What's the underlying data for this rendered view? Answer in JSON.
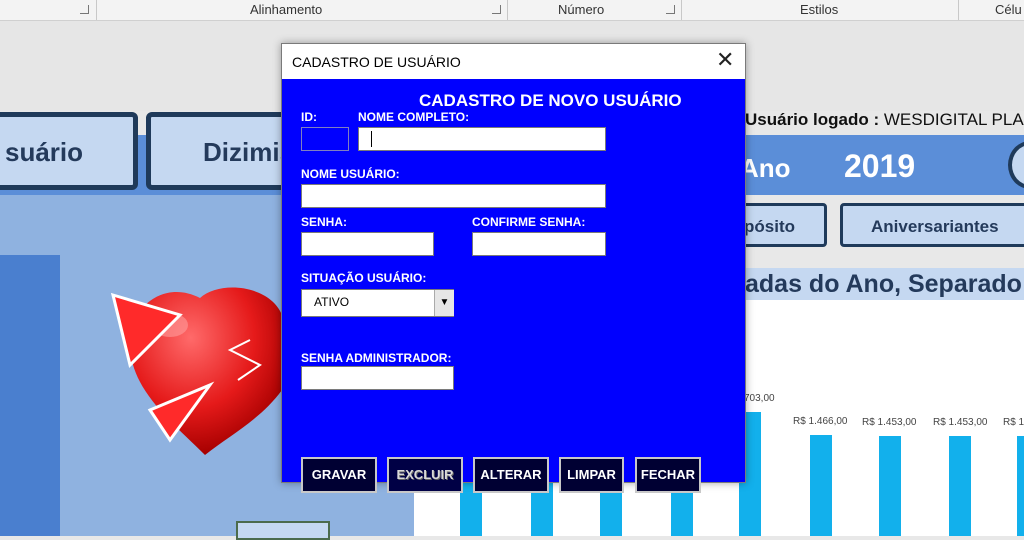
{
  "ribbon": {
    "groups": [
      "Alinhamento",
      "Número",
      "Estilos",
      "Célu"
    ]
  },
  "sheet": {
    "nav_buttons": [
      "suário",
      "Dizimis"
    ],
    "logged_label": "Usuário logado :",
    "logged_user": "WESDIGITAL PLA",
    "year_label": "Ano",
    "year_value": "2019",
    "tab_buttons": [
      "pósito",
      "Aniversariantes"
    ],
    "chart_title": "adas do Ano, Separado",
    "chart_values": [
      "703,00",
      "R$ 1.466,00",
      "R$ 1.453,00",
      "R$ 1.453,00",
      "R$ 1."
    ]
  },
  "dialog": {
    "title": "CADASTRO DE USUÁRIO",
    "heading": "CADASTRO DE NOVO USUÁRIO",
    "labels": {
      "id": "ID:",
      "full_name": "NOME COMPLETO:",
      "username": "NOME USUÁRIO:",
      "password": "SENHA:",
      "confirm_password": "CONFIRME SENHA:",
      "status": "SITUAÇÃO USUÁRIO:",
      "admin_password": "SENHA ADMINISTRADOR:"
    },
    "status_value": "ATIVO",
    "buttons": {
      "save": "GRAVAR",
      "delete": "EXCLUIR",
      "edit": "ALTERAR",
      "clear": "LIMPAR",
      "close": "FECHAR"
    }
  },
  "colors": {
    "dialog_body": "#0000ff",
    "button_bg": "#000033",
    "bar": "#12b0ec",
    "dashboard_blue": "#5b8ed8"
  }
}
